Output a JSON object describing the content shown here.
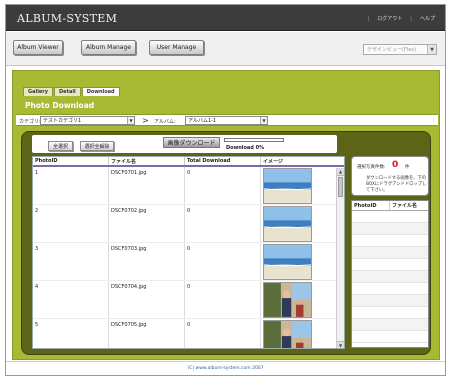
{
  "header": {
    "app_title": "ALBUM-SYSTEM",
    "logout": "ログアウト",
    "help": "ヘルプ",
    "separator": "|"
  },
  "nav": {
    "album_viewer": "Album Viewer",
    "album_manage": "Album Manage",
    "user_manage": "User Manage",
    "view_select": "デザインビュー(Flex)"
  },
  "tabs": [
    "Gallery",
    "Detail",
    "Download"
  ],
  "active_tab": "Download",
  "page_title": "Photo Download",
  "filters": {
    "category_label": "カテゴリ:",
    "category_value": "テストカテゴリ1",
    "arrow": ">",
    "album_label": "アルバム:",
    "album_value": "アルバム1-1"
  },
  "actions": {
    "select_all": "全選択",
    "deselect_all": "選択全解除",
    "image_download": "画像ダウンロード",
    "download_status": "Download 0%",
    "download_progress": 0
  },
  "grid": {
    "columns": [
      "PhotoID",
      "ファイル名",
      "Total Download",
      "イメージ"
    ],
    "rows": [
      {
        "id": "1",
        "file": "DSCF0701.jpg",
        "total": "0",
        "image": "beach-scene"
      },
      {
        "id": "2",
        "file": "DSCF0702.jpg",
        "total": "0",
        "image": "beach-scene"
      },
      {
        "id": "3",
        "file": "DSCF0703.jpg",
        "total": "0",
        "image": "beach-scene"
      },
      {
        "id": "4",
        "file": "DSCF0704.jpg",
        "total": "0",
        "image": "people-scene"
      },
      {
        "id": "5",
        "file": "DSCF0705.jpg",
        "total": "0",
        "image": "people-scene"
      }
    ]
  },
  "selection": {
    "label": "選択写真件数:",
    "count": "0",
    "unit": "件",
    "hint": "ダウンロードする画像を、下のBOXにドラグアンドドロップして下さい。"
  },
  "drop_list": {
    "columns": [
      "PhotoID",
      "ファイル名"
    ]
  },
  "footer": {
    "copyright": "(C) www.album-system.com 2007"
  },
  "colors": {
    "accent_olive": "#a8b933",
    "panel_dark": "#5d6418",
    "header_bg": "#3c3c3c",
    "count_red": "#e01010"
  }
}
